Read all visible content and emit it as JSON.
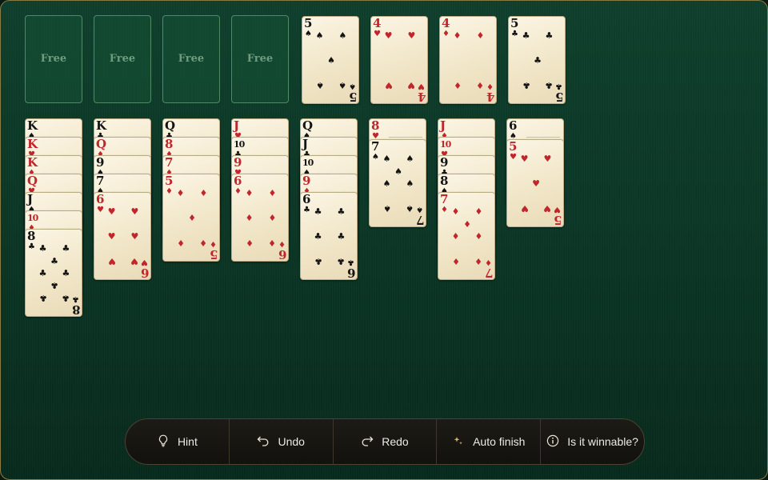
{
  "free_cells": [
    {
      "label": "Free"
    },
    {
      "label": "Free"
    },
    {
      "label": "Free"
    },
    {
      "label": "Free"
    }
  ],
  "foundations": [
    {
      "rank": "5",
      "suit": "♠",
      "color": "black"
    },
    {
      "rank": "4",
      "suit": "♥",
      "color": "red"
    },
    {
      "rank": "4",
      "suit": "♦",
      "color": "red"
    },
    {
      "rank": "5",
      "suit": "♣",
      "color": "black"
    }
  ],
  "tableau": [
    [
      {
        "rank": "K",
        "suit": "♠",
        "color": "black"
      },
      {
        "rank": "K",
        "suit": "♥",
        "color": "red"
      },
      {
        "rank": "K",
        "suit": "♦",
        "color": "red"
      },
      {
        "rank": "Q",
        "suit": "♥",
        "color": "red"
      },
      {
        "rank": "J",
        "suit": "♠",
        "color": "black"
      },
      {
        "rank": "10",
        "suit": "♦",
        "color": "red"
      },
      {
        "rank": "8",
        "suit": "♣",
        "color": "black"
      }
    ],
    [
      {
        "rank": "K",
        "suit": "♣",
        "color": "black"
      },
      {
        "rank": "Q",
        "suit": "♦",
        "color": "red"
      },
      {
        "rank": "9",
        "suit": "♠",
        "color": "black"
      },
      {
        "rank": "7",
        "suit": "♠",
        "color": "black"
      },
      {
        "rank": "6",
        "suit": "♥",
        "color": "red"
      }
    ],
    [
      {
        "rank": "Q",
        "suit": "♣",
        "color": "black"
      },
      {
        "rank": "8",
        "suit": "♦",
        "color": "red"
      },
      {
        "rank": "7",
        "suit": "♦",
        "color": "red"
      },
      {
        "rank": "5",
        "suit": "♦",
        "color": "red"
      }
    ],
    [
      {
        "rank": "J",
        "suit": "♥",
        "color": "red"
      },
      {
        "rank": "10",
        "suit": "♣",
        "color": "black"
      },
      {
        "rank": "9",
        "suit": "♥",
        "color": "red"
      },
      {
        "rank": "6",
        "suit": "♦",
        "color": "red"
      }
    ],
    [
      {
        "rank": "Q",
        "suit": "♠",
        "color": "black"
      },
      {
        "rank": "J",
        "suit": "♣",
        "color": "black"
      },
      {
        "rank": "10",
        "suit": "♠",
        "color": "black"
      },
      {
        "rank": "9",
        "suit": "♦",
        "color": "red"
      },
      {
        "rank": "6",
        "suit": "♣",
        "color": "black"
      }
    ],
    [
      {
        "rank": "8",
        "suit": "♥",
        "color": "red"
      },
      {
        "rank": "7",
        "suit": "♠",
        "color": "black"
      }
    ],
    [
      {
        "rank": "J",
        "suit": "♦",
        "color": "red"
      },
      {
        "rank": "10",
        "suit": "♥",
        "color": "red"
      },
      {
        "rank": "9",
        "suit": "♣",
        "color": "black"
      },
      {
        "rank": "8",
        "suit": "♠",
        "color": "black"
      },
      {
        "rank": "7",
        "suit": "♦",
        "color": "red"
      }
    ],
    [
      {
        "rank": "6",
        "suit": "♠",
        "color": "black"
      },
      {
        "rank": "5",
        "suit": "♥",
        "color": "red"
      }
    ]
  ],
  "toolbar": {
    "hint": {
      "icon": "lightbulb-icon",
      "label": "Hint"
    },
    "undo": {
      "icon": "undo-icon",
      "label": "Undo"
    },
    "redo": {
      "icon": "redo-icon",
      "label": "Redo"
    },
    "auto": {
      "icon": "sparkle-icon",
      "label": "Auto finish"
    },
    "winnable": {
      "icon": "info-icon",
      "label": "Is it winnable?"
    }
  },
  "colors": {
    "felt": "#0b3424",
    "card_red": "#c0262c",
    "card_black": "#141414",
    "frame_gold": "#8a7a45"
  }
}
